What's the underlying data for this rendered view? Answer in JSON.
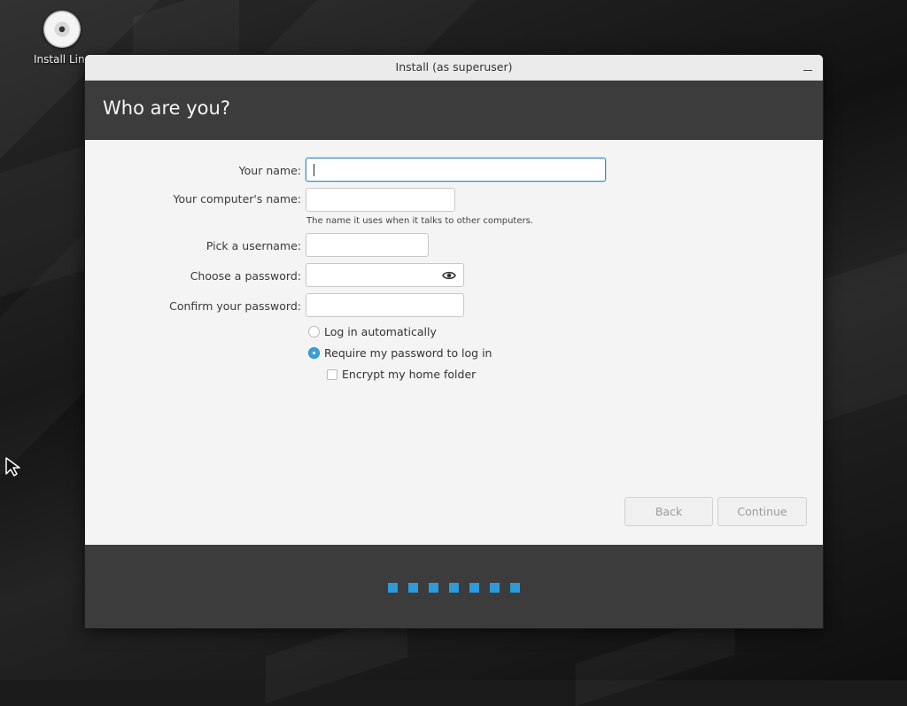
{
  "desktop": {
    "icon_label": "Install Lin"
  },
  "window": {
    "title": "Install (as superuser)"
  },
  "header": {
    "title": "Who are you?"
  },
  "form": {
    "your_name_label": "Your name:",
    "your_name_value": "",
    "computer_name_label": "Your computer's name:",
    "computer_name_value": "",
    "computer_name_hint": "The name it uses when it talks to other computers.",
    "username_label": "Pick a username:",
    "username_value": "",
    "password_label": "Choose a password:",
    "password_value": "",
    "confirm_label": "Confirm your password:",
    "confirm_value": ""
  },
  "options": {
    "login_auto": {
      "label": "Log in automatically",
      "checked": false
    },
    "require_password": {
      "label": "Require my password to log in",
      "checked": true
    },
    "encrypt_home": {
      "label": "Encrypt my home folder",
      "checked": false
    }
  },
  "buttons": {
    "back": "Back",
    "continue": "Continue"
  },
  "progress": {
    "steps": 7,
    "color": "#2d9ad9"
  },
  "colors": {
    "accent": "#3aa0d8",
    "header_bg": "#3c3c3c",
    "focus_border": "#3f8ec6"
  }
}
